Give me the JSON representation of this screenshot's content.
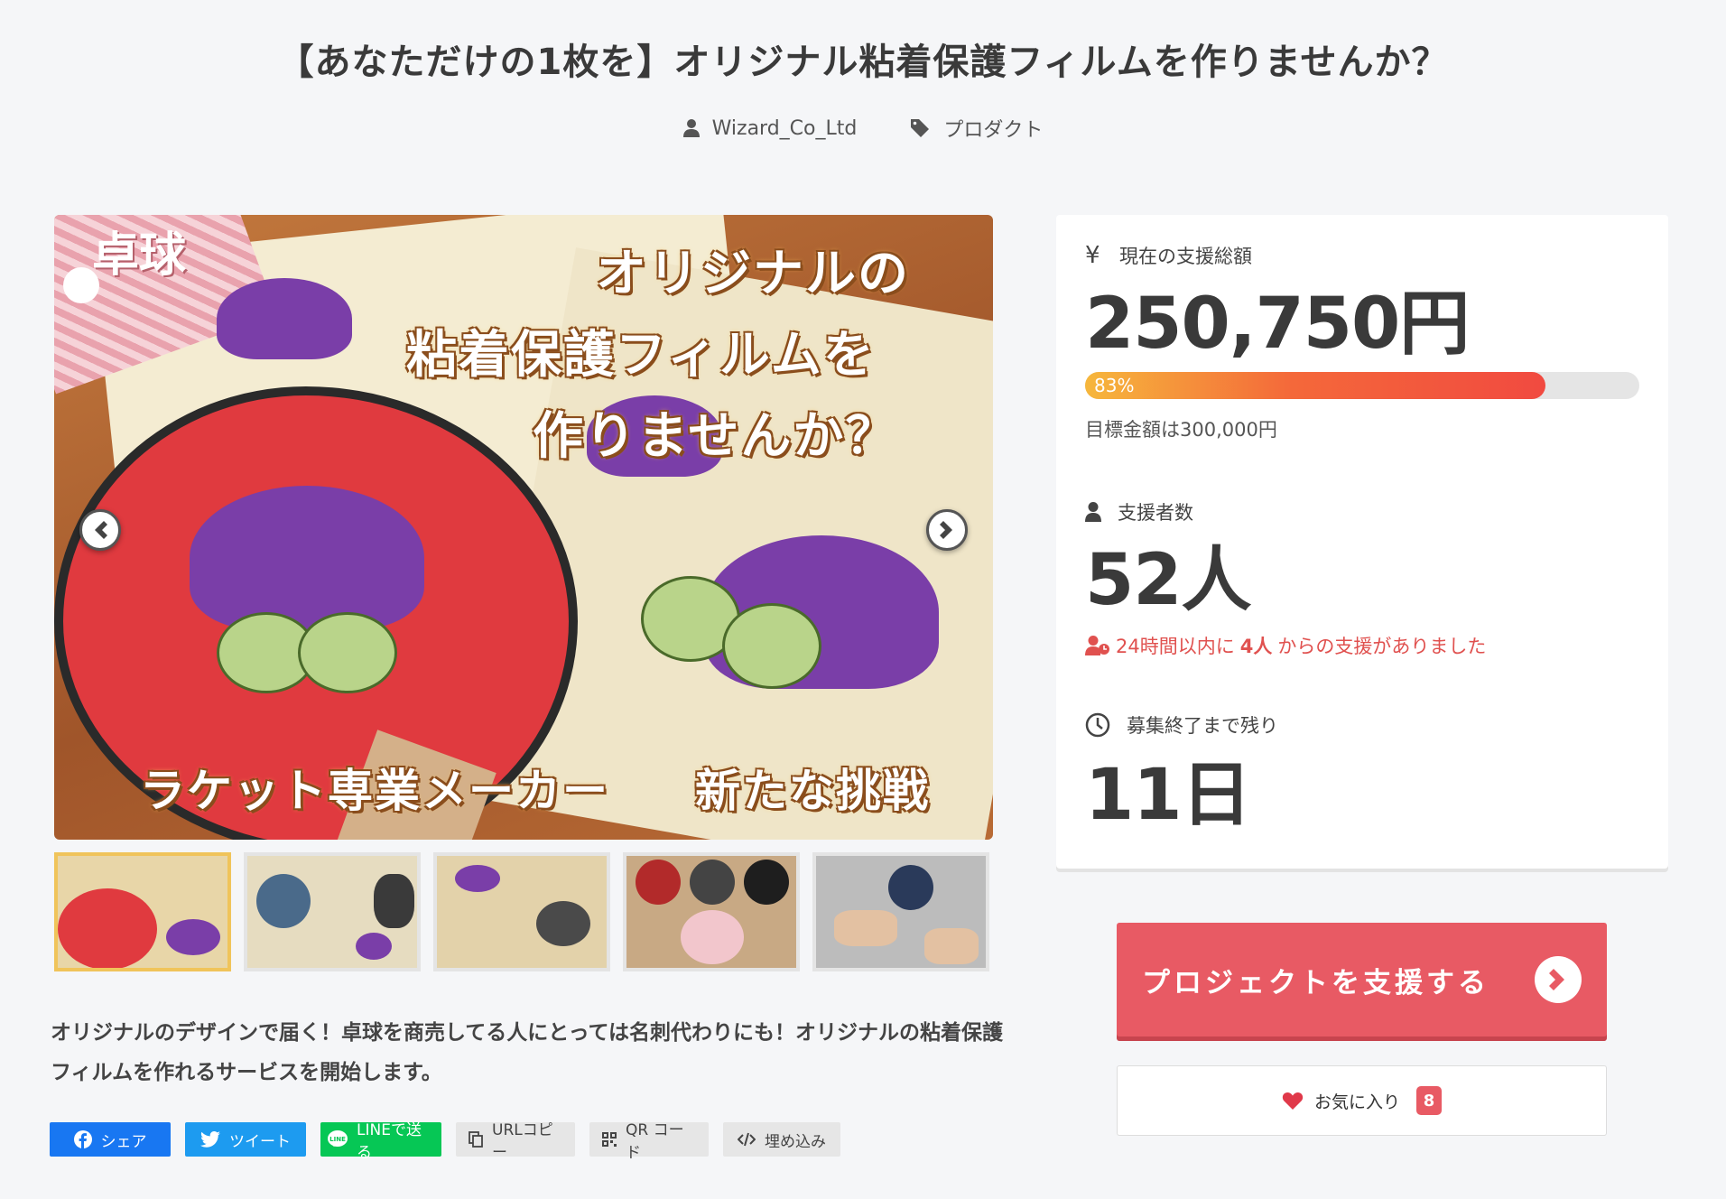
{
  "page": {
    "title": "【あなただけの1枚を】オリジナル粘着保護フィルムを作りませんか？",
    "author": "Wizard_Co_Ltd",
    "category": "プロダクト"
  },
  "hero": {
    "caption_tag": "卓球",
    "caption_line1": "オリジナルの",
    "caption_line2": "粘着保護フィルムを",
    "caption_line3": "作りませんか？",
    "caption_bottom_left": "ラケット専業メーカー",
    "caption_bottom_right": "新たな挑戦"
  },
  "description": "オリジナルのデザインで届く！卓球を商売してる人にとっては名刺代わりにも！オリジナルの粘着保護フィルムを作れるサービスを開始します。",
  "share": {
    "facebook": "シェア",
    "twitter": "ツイート",
    "line": "LINEで送る",
    "url_copy": "URLコピー",
    "qr": "QR コード",
    "embed": "埋め込み"
  },
  "stats": {
    "currency_symbol": "¥",
    "total_label": "現在の支援総額",
    "total_amount": "250,750円",
    "progress_percent": 83,
    "progress_label": "83%",
    "goal_text": "目標金額は300,000円",
    "backers_label": "支援者数",
    "backers_count": "52人",
    "recent_prefix": "24時間以内に",
    "recent_count": "4人",
    "recent_suffix": "からの支援がありました",
    "remaining_label": "募集終了まで残り",
    "remaining_value": "11日"
  },
  "actions": {
    "support_label": "プロジェクトを支援する",
    "favorite_label": "お気に入り",
    "favorite_count": "8"
  },
  "colors": {
    "accent": "#e85a64",
    "progress_start": "#f6b73c",
    "progress_end": "#f14a40",
    "recent_text": "#e0514f"
  }
}
